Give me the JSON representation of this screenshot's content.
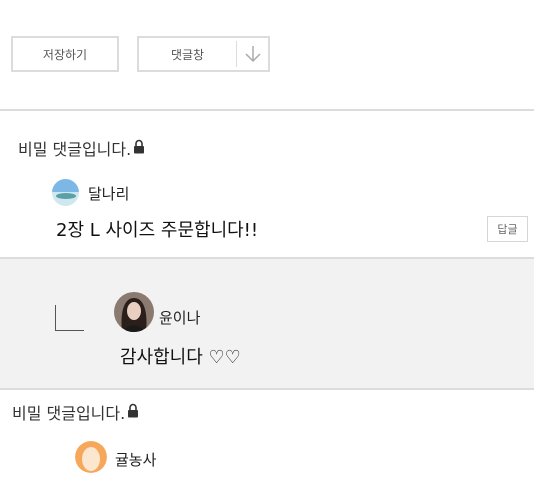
{
  "toolbar": {
    "save_label": "저장하기",
    "comments_label": "댓글창",
    "comments_icon": "arrow-down-icon"
  },
  "comments": [
    {
      "secret_label": "비밀 댓글입니다.",
      "secret_icon": "lock-icon",
      "author": "달나리",
      "text": "2장 L 사이즈 주문합니다!!",
      "reply_button": "답글",
      "reply": {
        "author": "윤이나",
        "text": "감사합니다 ♡♡"
      }
    },
    {
      "secret_label": "비밀 댓글입니다.",
      "secret_icon": "lock-icon",
      "author": "귤농사"
    }
  ],
  "colors": {
    "border": "#dcdcdc",
    "reply_background": "#f2f2f2"
  }
}
